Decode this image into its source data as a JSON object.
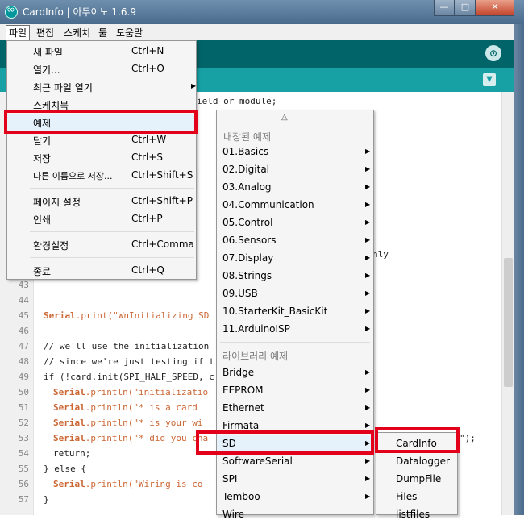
{
  "window": {
    "title": "CardInfo | 아두이노 1.6.9",
    "controls": {
      "minimize": "—",
      "maximize": "□",
      "close": "✕"
    }
  },
  "menubar": [
    "파일",
    "편집",
    "스케치",
    "툴",
    "도움말"
  ],
  "file_menu": [
    {
      "label": "새 파일",
      "shortcut": "Ctrl+N"
    },
    {
      "label": "열기...",
      "shortcut": "Ctrl+O"
    },
    {
      "label": "최근 파일 열기",
      "shortcut": ""
    },
    {
      "label": "스케치북",
      "shortcut": ""
    },
    {
      "label": "예제",
      "shortcut": ""
    },
    {
      "label": "닫기",
      "shortcut": "Ctrl+W"
    },
    {
      "label": "저장",
      "shortcut": "Ctrl+S"
    },
    {
      "label": "다른 이름으로 저장...",
      "shortcut": "Ctrl+Shift+S"
    },
    {
      "label": "페이지 설정",
      "shortcut": "Ctrl+Shift+P"
    },
    {
      "label": "인쇄",
      "shortcut": "Ctrl+P"
    },
    {
      "label": "환경설정",
      "shortcut": "Ctrl+Comma"
    },
    {
      "label": "종료",
      "shortcut": "Ctrl+Q"
    }
  ],
  "examples_menu": {
    "scroll_up": "△",
    "builtin_header": "내장된 예제",
    "builtin": [
      "01.Basics",
      "02.Digital",
      "03.Analog",
      "04.Communication",
      "05.Control",
      "06.Sensors",
      "07.Display",
      "08.Strings",
      "09.USB",
      "10.StarterKit_BasicKit",
      "11.ArduinoISP"
    ],
    "library_header": "라이브러리 예제",
    "libraries": [
      "Bridge",
      "EEPROM",
      "Ethernet",
      "Firmata",
      "SD",
      "SoftwareSerial",
      "SPI",
      "Temboo",
      "Wire"
    ]
  },
  "sd_menu": [
    "CardInfo",
    "Datalogger",
    "DumpFile",
    "Files",
    "listfiles"
  ],
  "editor": {
    "line_numbers": [
      "43",
      "44",
      "45",
      "46",
      "47",
      "48",
      "49",
      "50",
      "51",
      "52",
      "53",
      "54",
      "55",
      "56",
      "57"
    ],
    "partial_text": {
      "top": "ield or module;",
      "mid": "nly",
      "end": "\");"
    },
    "lines": {
      "l45_obj": "Serial",
      "l45_rest": ".print(\"WnInitializing SD",
      "l47": "// we'll use the initialization",
      "l48": "// since we're just testing if t",
      "l49": "if (!card.init(SPI_HALF_SPEED, c",
      "l50_obj": "Serial",
      "l50_rest": ".println(\"initializatio",
      "l51_obj": "Serial",
      "l51_rest": ".println(\"* is a card",
      "l52_obj": "Serial",
      "l52_rest": ".println(\"* is your wi",
      "l53_obj": "Serial",
      "l53_rest": ".println(\"* did you cha",
      "l54": "return;",
      "l55": "} else {",
      "l56_obj": "Serial",
      "l56_rest": ".println(\"Wiring is co",
      "l57": "}"
    }
  },
  "colors": {
    "toolbar": "#006468",
    "tabbar": "#17a1a5",
    "highlight": "#e2001a"
  },
  "icons": {
    "serial_monitor": "magnifier-icon",
    "tab_menu": "triangle-down-icon",
    "submenu": "triangle-right-icon"
  }
}
